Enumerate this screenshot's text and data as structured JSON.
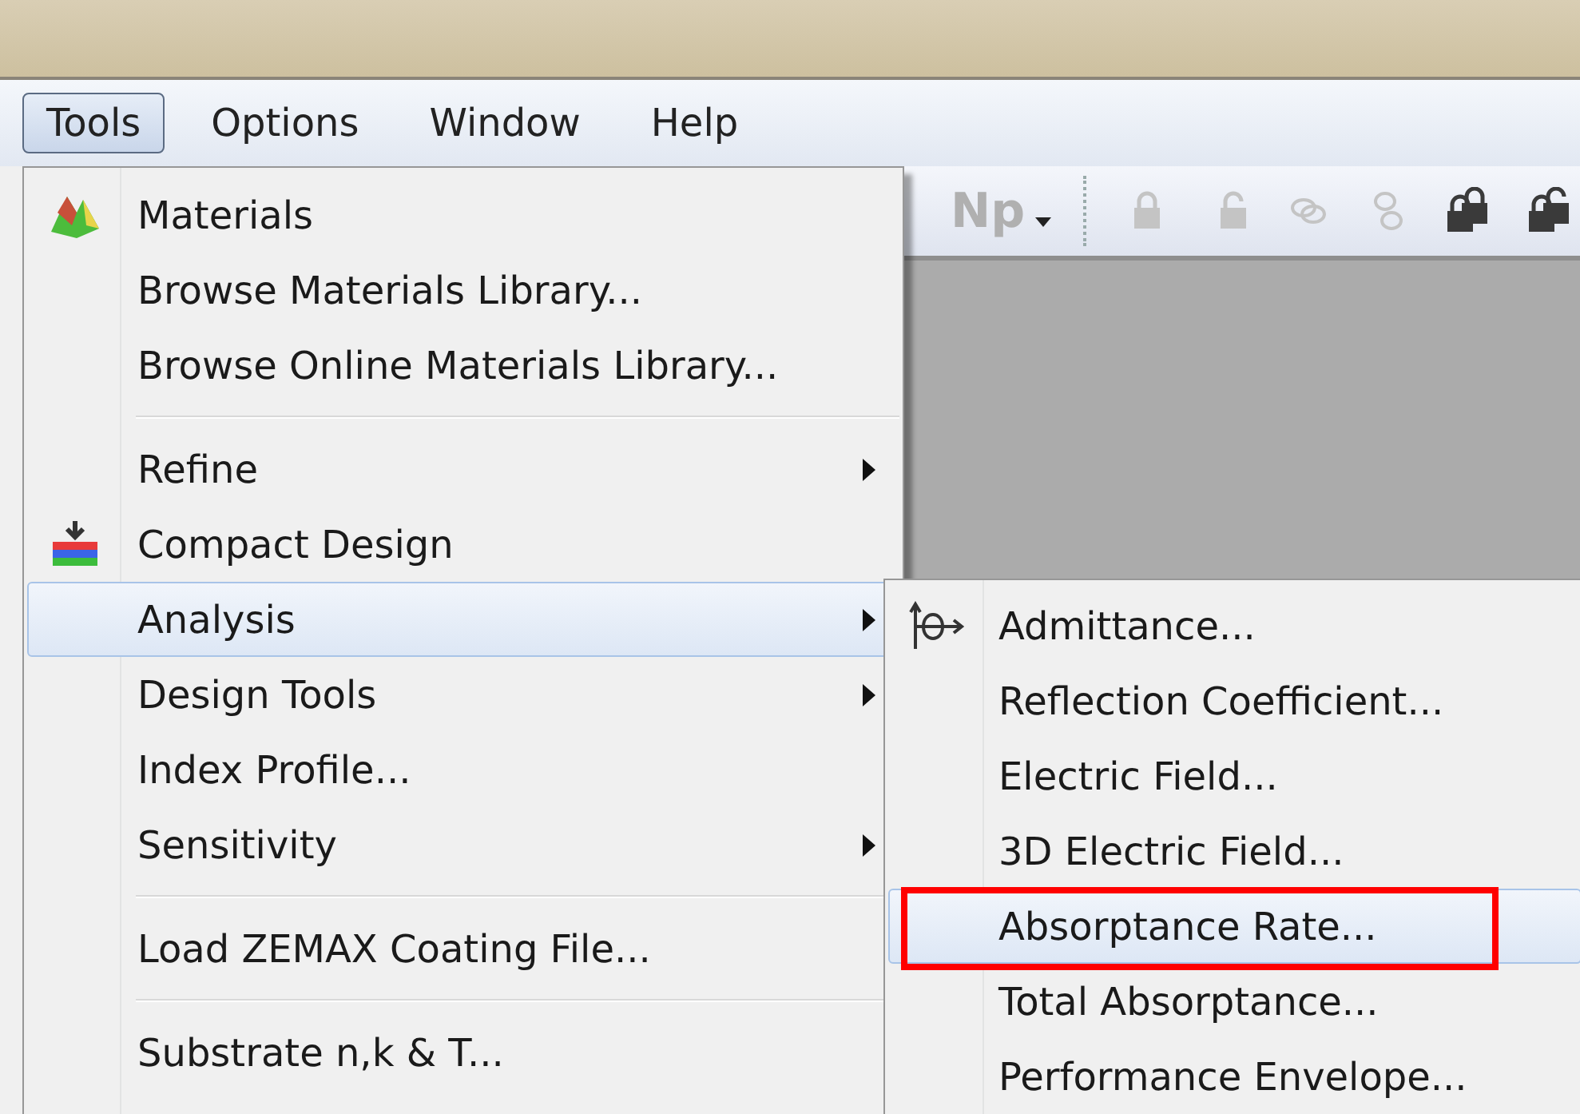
{
  "menubar": [
    {
      "label": "Tools",
      "selected": true
    },
    {
      "label": "Options",
      "selected": false
    },
    {
      "label": "Window",
      "selected": false
    },
    {
      "label": "Help",
      "selected": false
    }
  ],
  "toolbar": {
    "np_button": {
      "label": "Np",
      "disabled": true
    },
    "buttons": [
      {
        "disabled": true
      },
      {
        "disabled": true
      },
      {
        "disabled": true
      },
      {
        "disabled": true
      },
      {
        "disabled": false
      },
      {
        "disabled": false
      }
    ]
  },
  "tools_menu": [
    {
      "kind": "item",
      "label": "Materials",
      "submenu": false,
      "selected": false
    },
    {
      "kind": "item",
      "label": "Browse Materials Library...",
      "submenu": false,
      "selected": false
    },
    {
      "kind": "item",
      "label": "Browse Online Materials Library...",
      "submenu": false,
      "selected": false
    },
    {
      "kind": "separator"
    },
    {
      "kind": "item",
      "label": "Refine",
      "submenu": true,
      "selected": false
    },
    {
      "kind": "item",
      "label": "Compact Design",
      "submenu": false,
      "selected": false
    },
    {
      "kind": "item",
      "label": "Analysis",
      "submenu": true,
      "selected": true
    },
    {
      "kind": "item",
      "label": "Design Tools",
      "submenu": true,
      "selected": false
    },
    {
      "kind": "item",
      "label": "Index Profile...",
      "submenu": false,
      "selected": false
    },
    {
      "kind": "item",
      "label": "Sensitivity",
      "submenu": true,
      "selected": false
    },
    {
      "kind": "separator"
    },
    {
      "kind": "item",
      "label": "Load ZEMAX Coating File...",
      "submenu": false,
      "selected": false
    },
    {
      "kind": "separator"
    },
    {
      "kind": "item",
      "label": "Substrate n,k & T...",
      "submenu": false,
      "selected": false
    }
  ],
  "analysis_submenu": [
    {
      "label": "Admittance...",
      "selected": false,
      "annotated": false
    },
    {
      "label": "Reflection Coefficient...",
      "selected": false,
      "annotated": false
    },
    {
      "label": "Electric Field...",
      "selected": false,
      "annotated": false
    },
    {
      "label": "3D Electric Field...",
      "selected": false,
      "annotated": false
    },
    {
      "label": "Absorptance Rate...",
      "selected": true,
      "annotated": true
    },
    {
      "label": "Total Absorptance...",
      "selected": false,
      "annotated": false
    },
    {
      "label": "Performance Envelope...",
      "selected": false,
      "annotated": false
    }
  ]
}
